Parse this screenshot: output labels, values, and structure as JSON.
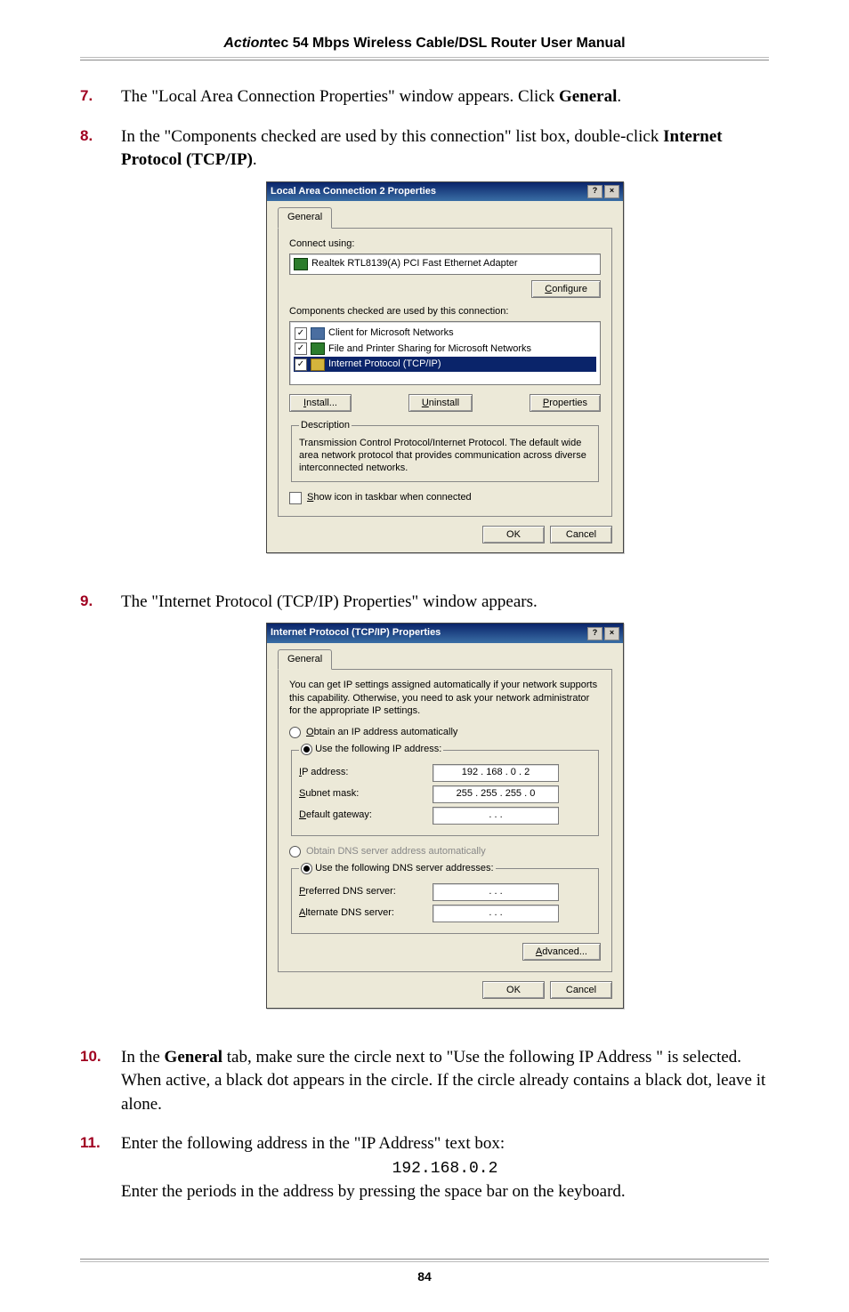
{
  "header": {
    "brand_ital": "Action",
    "brand_rest": "tec 54 Mbps Wireless Cable/DSL Router User Manual"
  },
  "footer": {
    "page": "84"
  },
  "steps": {
    "s7": {
      "num": "7.",
      "text": "The \"Local Area Connection Properties\" window appears. Click ",
      "bold_after": "General",
      "tail": "."
    },
    "s8": {
      "num": "8.",
      "text": "In the \"Components checked are used by this connection\" list box, double-click ",
      "bold_after": "Internet Protocol (TCP/IP)",
      "tail": "."
    },
    "s9": {
      "num": "9.",
      "text": "The \"Internet Protocol (TCP/IP) Properties\" window appears."
    },
    "s10": {
      "num": "10.",
      "lead": "In the ",
      "bold1": "General",
      "mid": " tab, make sure the circle next to \"Use the following IP Address \" is selected. When active, a black dot appears in the circle. If the circle already contains a black dot, leave it alone."
    },
    "s11": {
      "num": "11.",
      "line1": "Enter the following address in the \"IP Address\" text box:",
      "code": "192.168.0.2",
      "line2": "Enter the periods in the address by pressing the space bar on the keyboard."
    }
  },
  "dlg1": {
    "title": "Local Area Connection 2 Properties",
    "tab": "General",
    "connect_label": "Connect using:",
    "adapter": "Realtek RTL8139(A) PCI Fast Ethernet Adapter",
    "configure": "Configure",
    "components_label": "Components checked are used by this connection:",
    "items": {
      "client": "Client for Microsoft Networks",
      "share": "File and Printer Sharing for Microsoft Networks",
      "tcpip": "Internet Protocol (TCP/IP)"
    },
    "install": "Install...",
    "uninstall": "Uninstall",
    "properties": "Properties",
    "desc_title": "Description",
    "desc": "Transmission Control Protocol/Internet Protocol. The default wide area network protocol that provides communication across diverse interconnected networks.",
    "show_icon": "Show icon in taskbar when connected",
    "ok": "OK",
    "cancel": "Cancel"
  },
  "dlg2": {
    "title": "Internet Protocol (TCP/IP) Properties",
    "tab": "General",
    "intro": "You can get IP settings assigned automatically if your network supports this capability. Otherwise, you need to ask your network administrator for the appropriate IP settings.",
    "radio_obtain_ip": "Obtain an IP address automatically",
    "radio_use_ip": "Use the following IP address:",
    "ip_label": "IP address:",
    "ip_value": "192 . 168 .   0  .   2",
    "subnet_label": "Subnet mask:",
    "subnet_value": "255 . 255 . 255 .   0",
    "gateway_label": "Default gateway:",
    "dots": ".      .      .",
    "radio_obtain_dns": "Obtain DNS server address automatically",
    "radio_use_dns": "Use the following DNS server addresses:",
    "pref_dns_label": "Preferred DNS server:",
    "alt_dns_label": "Alternate DNS server:",
    "advanced": "Advanced...",
    "ok": "OK",
    "cancel": "Cancel"
  }
}
